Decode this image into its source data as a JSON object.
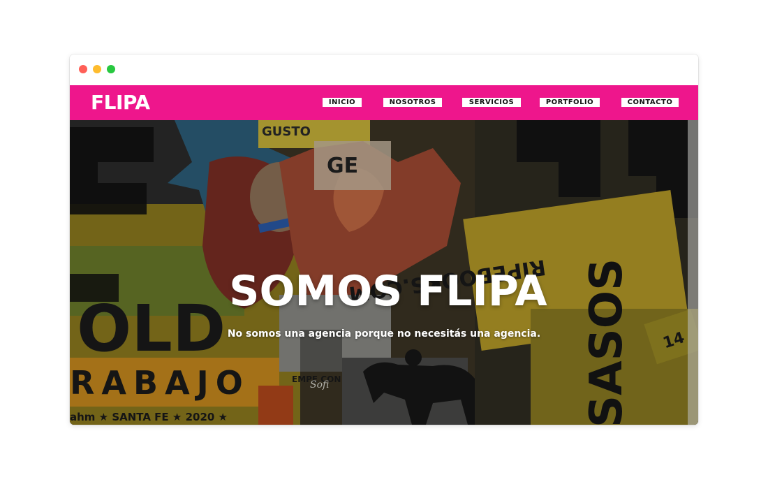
{
  "brand": {
    "logo_text": "FLIPA",
    "accent": "#ee168c"
  },
  "window_controls": [
    "close",
    "minimize",
    "maximize"
  ],
  "nav": {
    "items": [
      {
        "label": "INICIO"
      },
      {
        "label": "NOSOTROS"
      },
      {
        "label": "SERVICIOS"
      },
      {
        "label": "PORTFOLIO"
      },
      {
        "label": "CONTACTO"
      }
    ]
  },
  "hero": {
    "title": "SOMOS FLIPA",
    "subtitle": "No somos una agencia porque no necesitás una agencia.",
    "background_posters": {
      "left_block": "OLD",
      "left_bottom": "RABAJO",
      "left_footer": "ahm ★ SANTA FE ★ 2020 ★",
      "right_url": "RIPEBOOKS.COM",
      "right_vertical": "SASOS",
      "top_text": "GUSTO",
      "small_sign": "EMPE CON EL",
      "handwritten": "Sofi"
    }
  }
}
